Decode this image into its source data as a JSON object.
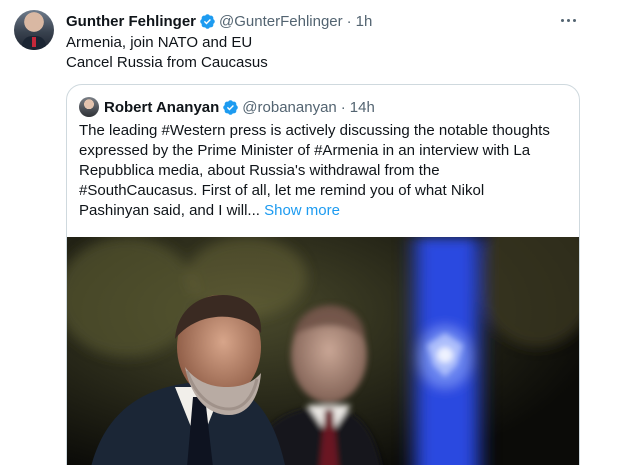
{
  "tweet": {
    "author_name": "Gunther Fehlinger",
    "author_handle": "@GunterFehlinger",
    "time": "1h",
    "separator": "·",
    "lines": [
      "Armenia, join NATO and EU",
      "Cancel Russia from Caucasus"
    ]
  },
  "quoted": {
    "author_name": "Robert Ananyan",
    "author_handle": "@robananyan",
    "time": "14h",
    "separator": "·",
    "lines": [
      "The leading #Western press is actively discussing the notable thoughts",
      "expressed by the Prime Minister of #Armenia in an interview with La",
      "Repubblica media, about Russia's withdrawal from the",
      "#SouthCaucasus. First of all, let me remind you of what Nikol"
    ],
    "last_line": "Pashinyan said, and I will...",
    "show_more": "Show more"
  },
  "colors": {
    "verified": "#1d9bf0",
    "link": "#1d9bf0",
    "secondary_text": "#536471",
    "border": "#cfd9de"
  },
  "icons": {
    "verified": "verified-badge-icon",
    "more": "more-options-icon"
  }
}
